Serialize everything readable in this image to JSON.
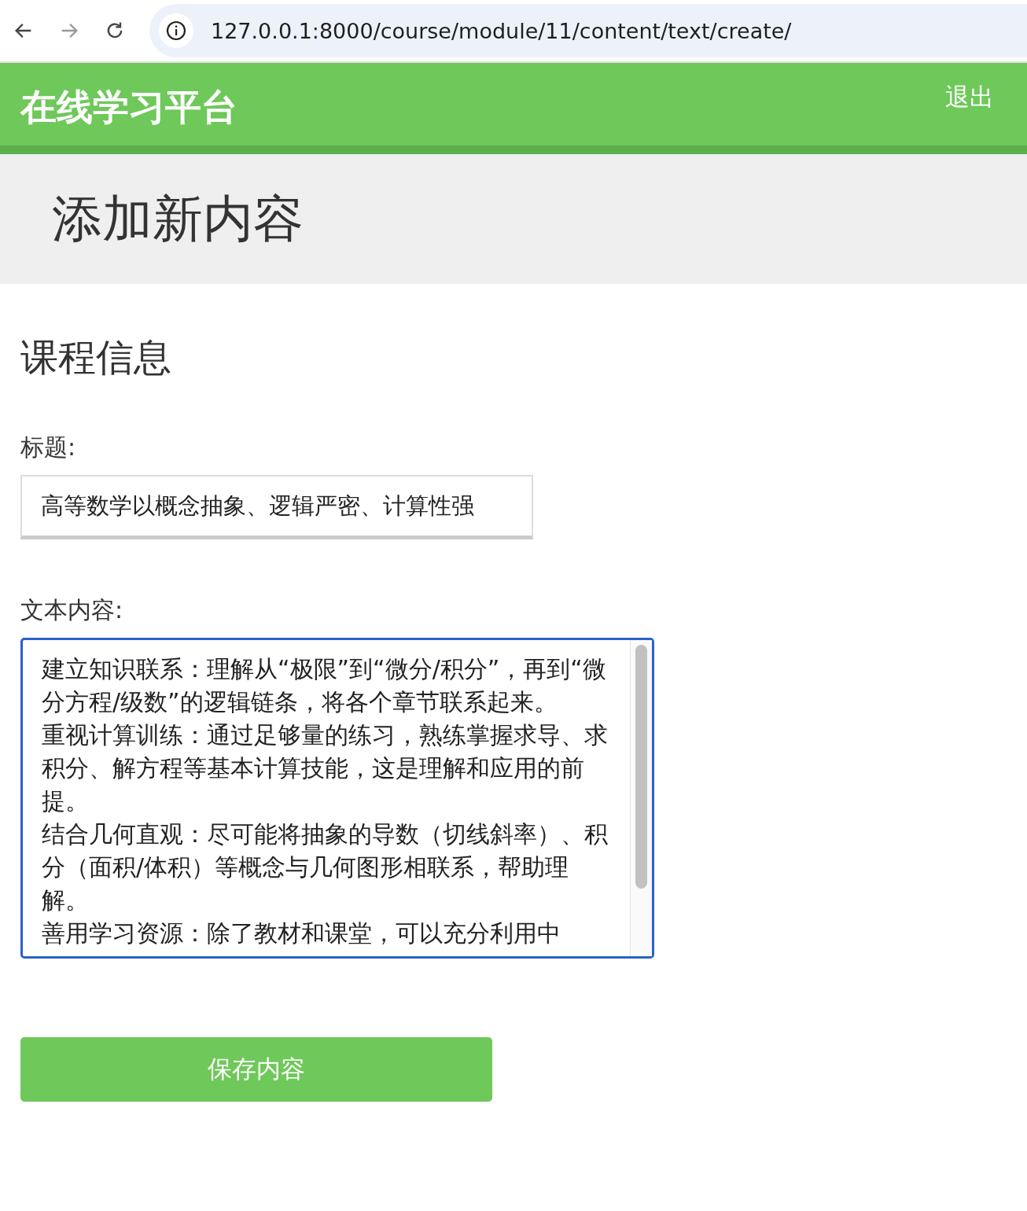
{
  "browser": {
    "url": "127.0.0.1:8000/course/module/11/content/text/create/"
  },
  "header": {
    "logo": "在线学习平台",
    "logout": "退出"
  },
  "page_title": "添加新内容",
  "section_title": "课程信息",
  "form": {
    "fields": [
      {
        "kind": "input",
        "label": "标题:",
        "value": "高等数学以概念抽象、逻辑严密、计算性强"
      },
      {
        "kind": "textarea",
        "label": "文本内容:",
        "focused": true,
        "paragraphs": [
          "建立知识联系：理解从“极限”到“微分/积分”，再到“微分方程/级数”的逻辑链条，将各个章节联系起来。",
          "重视计算训练：通过足够量的练习，熟练掌握求导、求积分、解方程等基本计算技能，这是理解和应用的前提。",
          "结合几何直观：尽可能将抽象的导数（切线斜率）、积分（面积/体积）等概念与几何图形相联系，帮助理解。",
          "善用学习资源：除了教材和课堂，可以充分利用中"
        ]
      }
    ],
    "submit": "保存内容"
  }
}
